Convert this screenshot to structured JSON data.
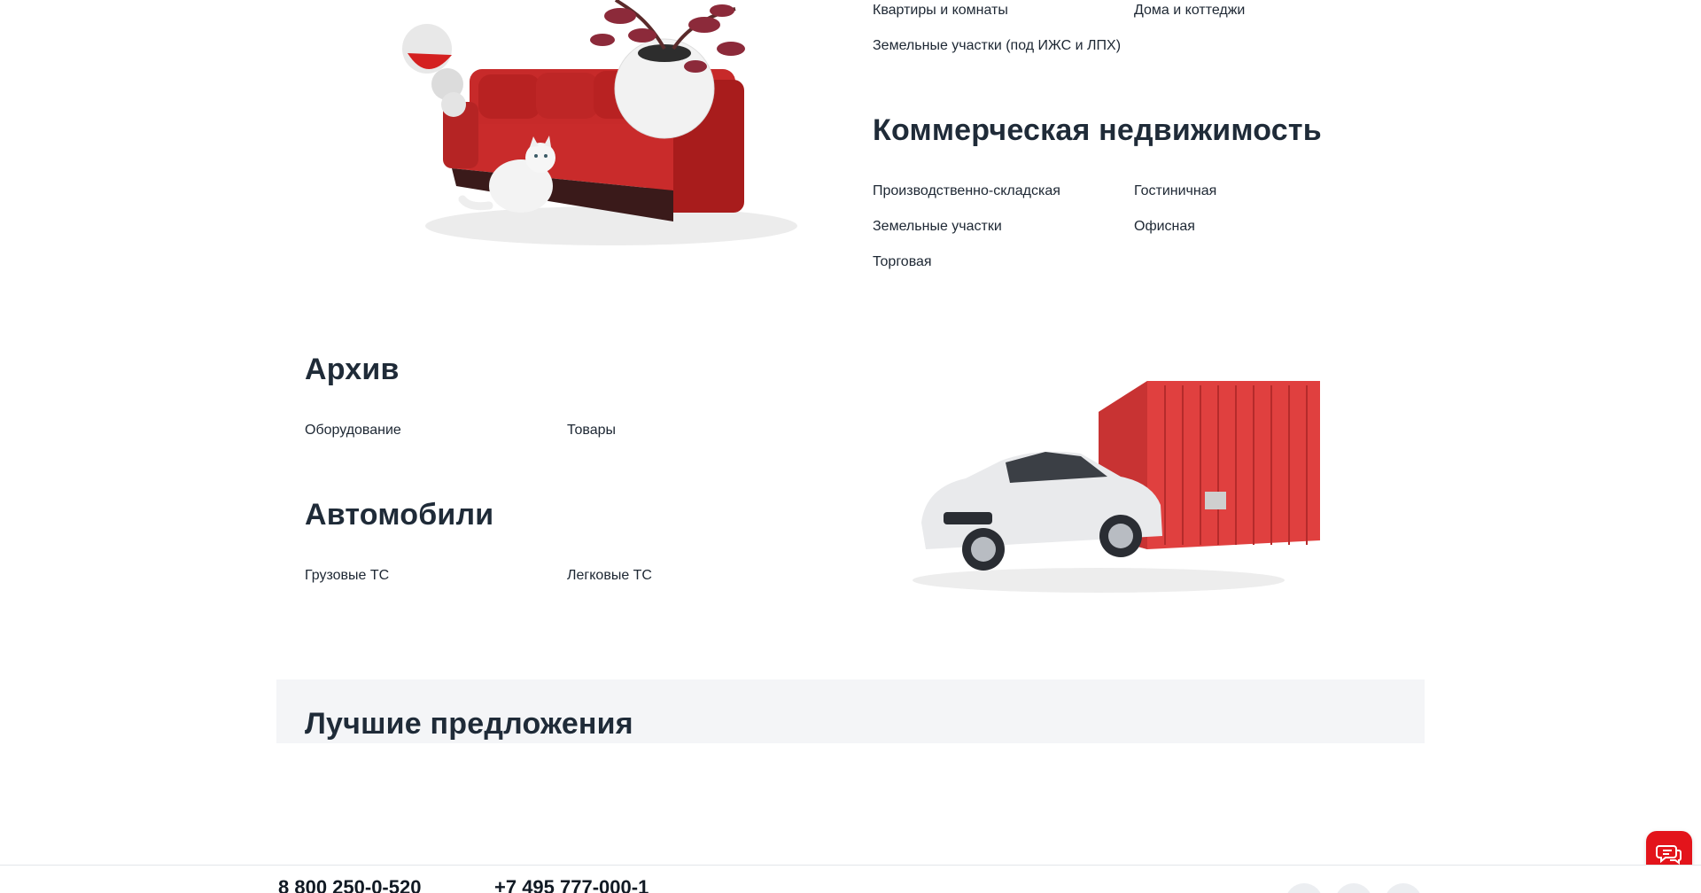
{
  "residential": {
    "links": [
      "Квартиры и комнаты",
      "Дома и коттеджи",
      "Земельные участки (под ИЖС и ЛПХ)"
    ]
  },
  "commercial": {
    "title": "Коммерческая недвижимость",
    "links": [
      "Производственно-складская",
      "Гостиничная",
      "Земельные участки",
      "Офисная",
      "Торговая"
    ]
  },
  "archive": {
    "title": "Архив",
    "links": [
      "Оборудование",
      "Товары"
    ]
  },
  "cars": {
    "title": "Автомобили",
    "links": [
      "Грузовые ТС",
      "Легковые ТС"
    ]
  },
  "best_offers": {
    "title": "Лучшие предложения"
  },
  "footer": {
    "phones": [
      "8 800 250-0-520",
      "+7 495 777-000-1"
    ]
  },
  "colors": {
    "accent": "#e3141b",
    "text": "#1d2733",
    "band": "#f4f5f7"
  },
  "icons": {
    "chat": "chat-bubbles-icon",
    "social": "social-icon"
  }
}
